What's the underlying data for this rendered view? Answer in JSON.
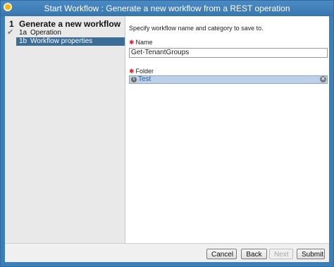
{
  "window": {
    "title": "Start Workflow : Generate a new workflow from a REST operation",
    "app_icon": "vco-orange-circle-icon"
  },
  "sidebar": {
    "step": {
      "number": "1",
      "label": "Generate a new workflow ..."
    },
    "substeps": [
      {
        "number": "1a",
        "label": "Operation",
        "completed": true,
        "active": false
      },
      {
        "number": "1b",
        "label": "Workflow properties",
        "completed": false,
        "active": true
      }
    ],
    "colors": {
      "background": "#e9e9e9",
      "active": "#3d6d97"
    }
  },
  "form": {
    "hint": "Specify workflow name and category to save to.",
    "required_marker": "✱",
    "name": {
      "label": "Name",
      "value": "Get-TenantGroups"
    },
    "folder": {
      "label": "Folder",
      "value": "Test",
      "icon": "info-icon",
      "clear_icon": "clear-icon"
    }
  },
  "footer": {
    "buttons": [
      {
        "label": "Cancel",
        "enabled": true
      },
      {
        "label": "Back",
        "enabled": true
      },
      {
        "label": "Next",
        "enabled": false
      },
      {
        "label": "Submit",
        "enabled": true
      }
    ]
  }
}
